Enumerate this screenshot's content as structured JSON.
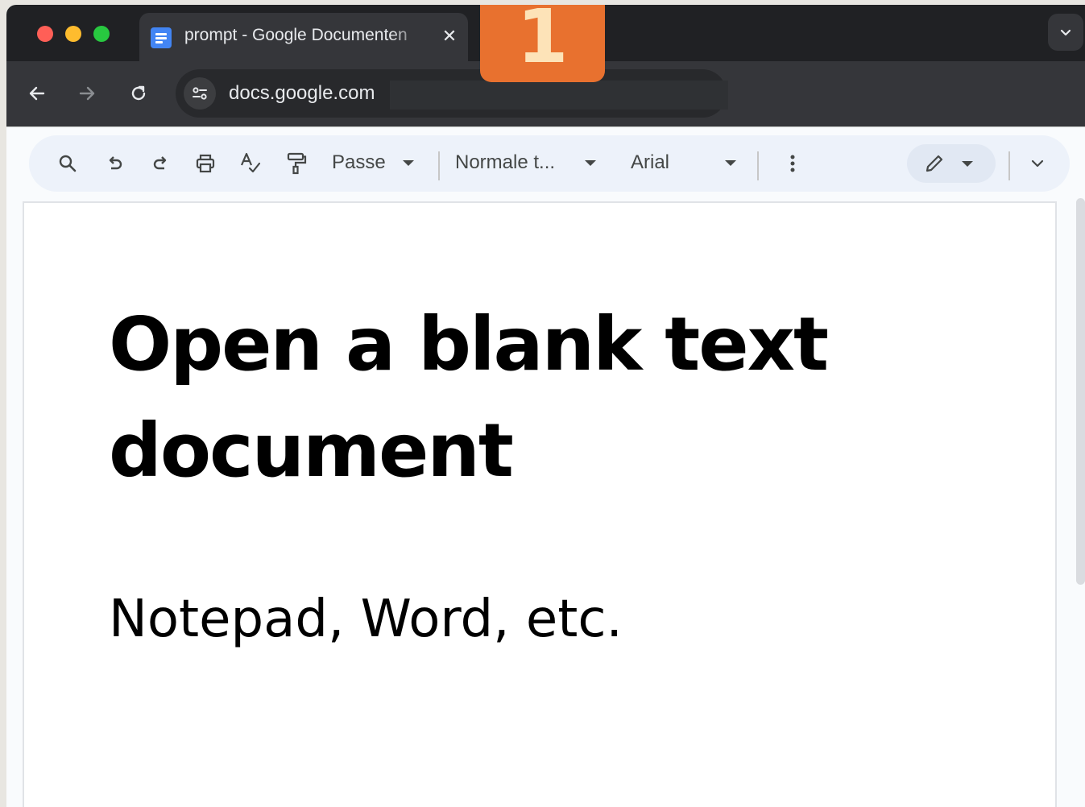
{
  "browser": {
    "tab": {
      "title": "prompt - Google Documenten",
      "close_glyph": "✕",
      "favicon": "google-docs-icon"
    },
    "address_bar": {
      "url": "docs.google.com"
    },
    "step_badge": "1",
    "colors": {
      "chrome_dark": "#202124",
      "toolbar": "#35363a",
      "badge": "#e8712f",
      "badge_text": "#fde3b8",
      "traffic_red": "#ff5f57",
      "traffic_yellow": "#febc2e",
      "traffic_green": "#28c840"
    }
  },
  "docs_toolbar": {
    "zoom": "Passe",
    "style": "Normale t...",
    "font": "Arial",
    "icons": [
      "search-icon",
      "undo-icon",
      "redo-icon",
      "print-icon",
      "spellcheck-icon",
      "paint-format-icon",
      "more-vert-icon",
      "edit-pencil-icon",
      "collapse-chevron-icon"
    ]
  },
  "document": {
    "heading": "Open a blank text document",
    "body": "Notepad, Word, etc."
  }
}
